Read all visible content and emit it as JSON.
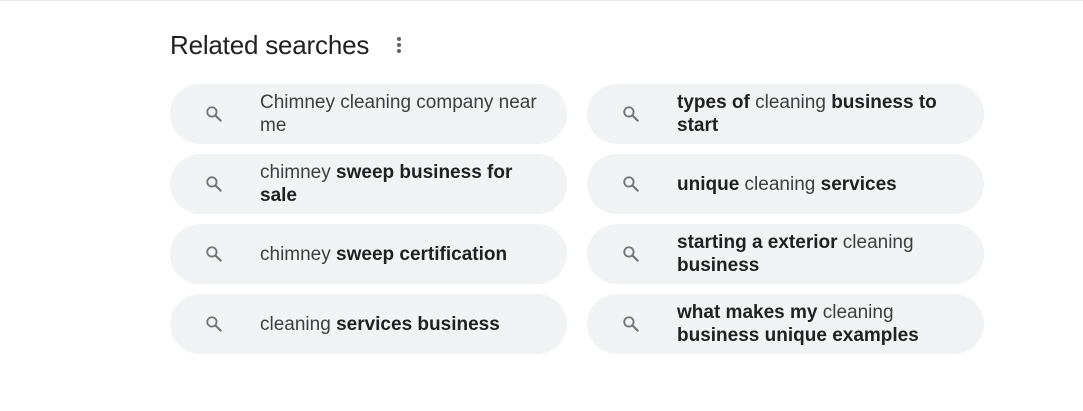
{
  "header": {
    "title": "Related searches",
    "more_icon": "more-vert-icon"
  },
  "search_icon": "search-icon",
  "colors": {
    "chip_background": "#f1f3f4",
    "text": "#3c4043",
    "bold_text": "#202124",
    "icon": "#70757a"
  },
  "related": [
    {
      "parts": [
        {
          "text": "Chimney cleaning company near me",
          "bold": false
        }
      ]
    },
    {
      "parts": [
        {
          "text": "types of",
          "bold": true
        },
        {
          "text": " cleaning ",
          "bold": false
        },
        {
          "text": "business to start",
          "bold": true
        }
      ]
    },
    {
      "parts": [
        {
          "text": "chimney ",
          "bold": false
        },
        {
          "text": "sweep business for sale",
          "bold": true
        }
      ]
    },
    {
      "parts": [
        {
          "text": "unique",
          "bold": true
        },
        {
          "text": " cleaning ",
          "bold": false
        },
        {
          "text": "services",
          "bold": true
        }
      ]
    },
    {
      "parts": [
        {
          "text": "chimney ",
          "bold": false
        },
        {
          "text": "sweep certification",
          "bold": true
        }
      ]
    },
    {
      "parts": [
        {
          "text": "starting a exterior",
          "bold": true
        },
        {
          "text": " cleaning ",
          "bold": false
        },
        {
          "text": "business",
          "bold": true
        }
      ]
    },
    {
      "parts": [
        {
          "text": "cleaning ",
          "bold": false
        },
        {
          "text": "services business",
          "bold": true
        }
      ]
    },
    {
      "parts": [
        {
          "text": "what makes my",
          "bold": true
        },
        {
          "text": " cleaning ",
          "bold": false
        },
        {
          "text": "business unique examples",
          "bold": true
        }
      ]
    }
  ]
}
